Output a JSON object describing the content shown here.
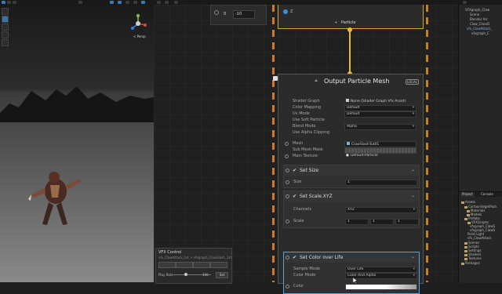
{
  "scene_view": {
    "projection_label": "< Persp",
    "gizmo_axes": {
      "x": "x",
      "y": "y",
      "z": "z"
    }
  },
  "vfx_control": {
    "title": "VFX Control",
    "subtitle": "vfx_ClawAttack_1st > vfxgraph_ClawSlash_1st",
    "play_rate_label": "Play Rate",
    "play_rate_value": "100",
    "set_label": "Set",
    "play_rate": 0.33
  },
  "graph": {
    "small_node": {
      "label": "B",
      "value": "-10"
    },
    "particle_node": {
      "field_label": "Z",
      "title": "Particle"
    },
    "output_node": {
      "title": "Output Particle Mesh",
      "badge": "LOCAL",
      "properties": [
        {
          "label": "Shader Graph",
          "value": "None (Shader Graph Vfx Asset)",
          "type": "object"
        },
        {
          "label": "Color Mapping",
          "value": "Default",
          "type": "dropdown"
        },
        {
          "label": "Uv Mode",
          "value": "Default",
          "type": "dropdown"
        },
        {
          "label": "Use Soft Particle",
          "value": "",
          "type": "none"
        },
        {
          "label": "Blend Mode",
          "value": "Alpha",
          "type": "dropdown"
        },
        {
          "label": "Use Alpha Clipping",
          "value": "",
          "type": "none"
        }
      ],
      "inputs": [
        {
          "label": "Mesh",
          "value": "ClawSlashTut01",
          "type": "object"
        },
        {
          "label": "Sub Mesh Mask",
          "value": "",
          "type": "mask"
        },
        {
          "label": "Main Texture",
          "value": "Default-Particle",
          "type": "object"
        }
      ],
      "blocks": [
        {
          "title": "Set Size",
          "rows": [
            {
              "label": "Size",
              "value": "1"
            }
          ]
        },
        {
          "title": "Set Scale.XYZ",
          "rows": [
            {
              "label": "Channels",
              "value": "XYZ"
            },
            {
              "label": "Scale",
              "x": "1",
              "y": "1",
              "z": "1"
            }
          ]
        },
        {
          "title": "Set Color over Life",
          "rows": [
            {
              "label": "Sample Mode",
              "value": "Over Life"
            },
            {
              "label": "Color Mode",
              "value": "Color And Alpha"
            },
            {
              "label": "Color",
              "value": ""
            }
          ]
        }
      ]
    }
  },
  "hierarchy": {
    "items": [
      "VFXgraph_Claw",
      "Scene",
      "Blender Arr",
      "Claw_ClassD",
      "vfx_ClawAttack_",
      "vfxgraph_C"
    ]
  },
  "project": {
    "tabs": [
      "Project",
      "Console"
    ],
    "items": [
      "Assets",
      "CartoonVegetPack",
      "Materials",
      "Models",
      "Prefabs",
      "VFXGraphs",
      "vfxgraph_ClawS",
      "vfxgraph_ClawS",
      "Point Light",
      "vfx_ClawAttack",
      "Scenes",
      "Scripts",
      "Settings",
      "Shaders",
      "Textures",
      "Packages"
    ]
  },
  "colors": {
    "accent_orange": "#e8b83c",
    "selection_blue": "#4ea4e0",
    "context_dash": "#c8801e"
  }
}
